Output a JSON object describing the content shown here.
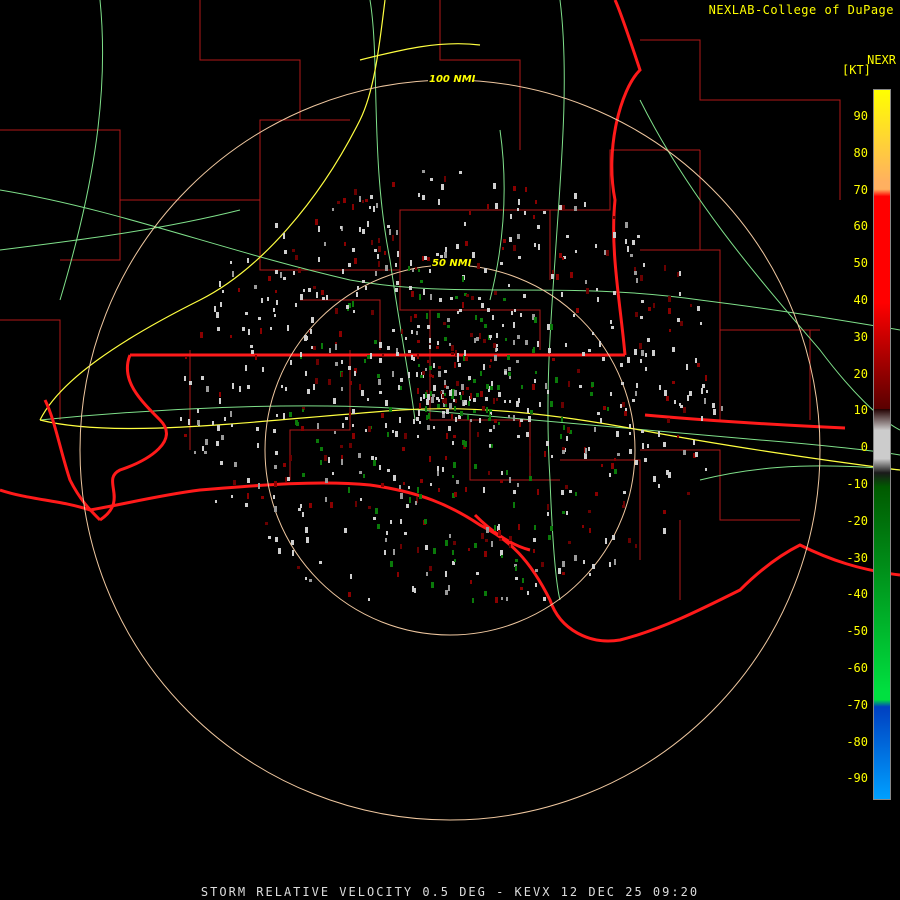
{
  "header": {
    "credit": "NEXLAB-College of DuPage",
    "product": "NEXR",
    "units": "[KT]"
  },
  "range_rings": {
    "inner_label": "50 NMI",
    "outer_label": "100 NMI"
  },
  "legend": {
    "ticks": [
      "90",
      "80",
      "70",
      "60",
      "50",
      "40",
      "30",
      "20",
      "10",
      "0",
      "-10",
      "-20",
      "-30",
      "-40",
      "-50",
      "-60",
      "-70",
      "-80",
      "-90"
    ],
    "colors": {
      "high_yellow": "#ffff00",
      "orange": "#ffb060",
      "red": "#ff0000",
      "dark_red": "#5a0000",
      "gray": "#cccccc",
      "dark_green": "#005a00",
      "green": "#00e040",
      "blue": "#0040c0",
      "cyan": "#00a0ff"
    }
  },
  "colors": {
    "background": "#000000",
    "county_lines": "#b01818",
    "state_lines": "#ff1a1a",
    "roads": "#7fe08a",
    "interstates": "#ffff40",
    "range_rings": "#f0c8a0"
  },
  "footer": {
    "caption": "STORM RELATIVE VELOCITY 0.5 DEG - KEVX 12 DEC 25 09:20"
  }
}
